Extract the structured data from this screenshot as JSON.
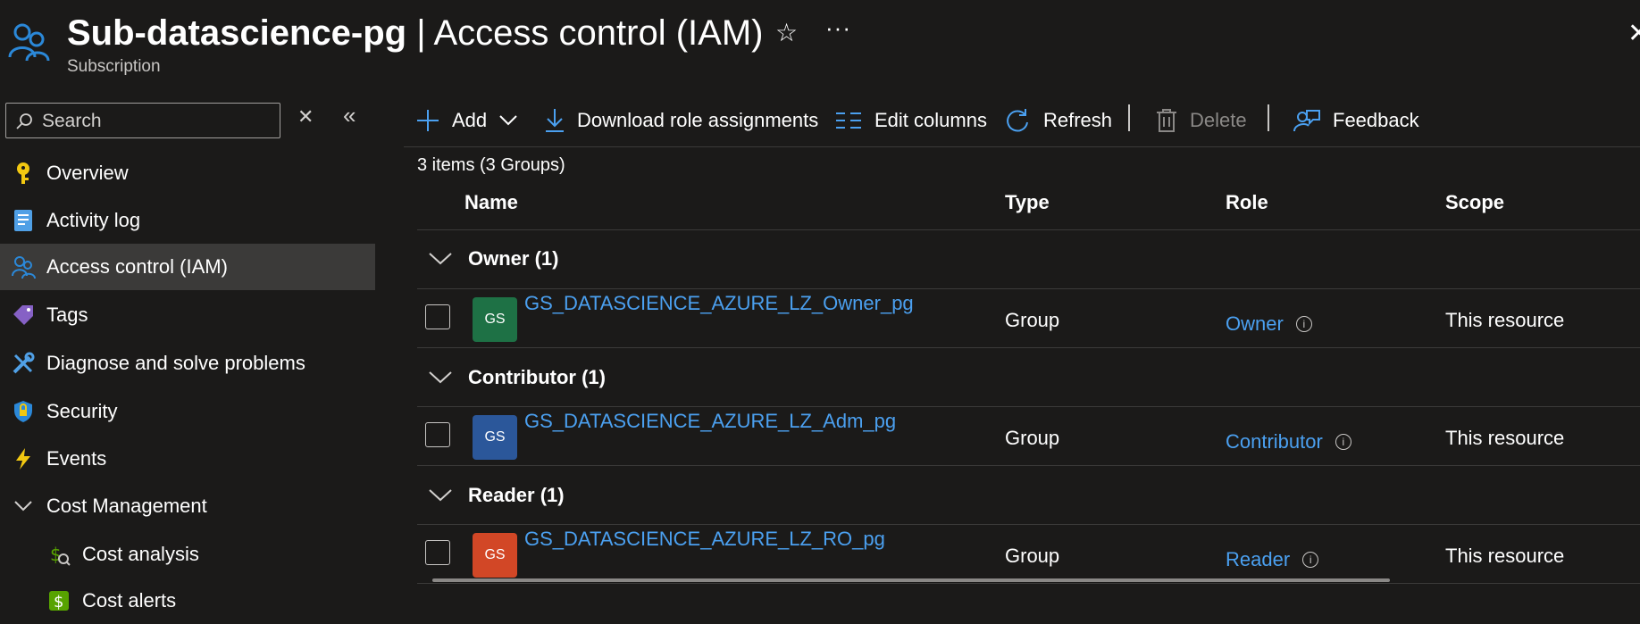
{
  "header": {
    "title_resource": "Sub-datascience-pg",
    "title_separator": "|",
    "title_page": "Access control (IAM)",
    "subtitle": "Subscription",
    "favorite_icon": "star-icon",
    "more_icon": "more-icon",
    "close_icon": "close-icon"
  },
  "search": {
    "placeholder": "Search",
    "value": ""
  },
  "sidebar": {
    "items": [
      {
        "label": "Overview",
        "icon": "key-icon"
      },
      {
        "label": "Activity log",
        "icon": "activity-log-icon"
      },
      {
        "label": "Access control (IAM)",
        "icon": "people-icon",
        "selected": true
      },
      {
        "label": "Tags",
        "icon": "tag-icon"
      },
      {
        "label": "Diagnose and solve problems",
        "icon": "wrench-icon"
      },
      {
        "label": "Security",
        "icon": "shield-icon"
      },
      {
        "label": "Events",
        "icon": "lightning-icon"
      },
      {
        "label": "Cost Management",
        "icon": "chevron-down-icon",
        "expanded": true
      },
      {
        "label": "Cost analysis",
        "icon": "cost-analysis-icon"
      },
      {
        "label": "Cost alerts",
        "icon": "cost-alerts-icon"
      }
    ]
  },
  "toolbar": {
    "add": "Add",
    "download": "Download role assignments",
    "edit_columns": "Edit columns",
    "refresh": "Refresh",
    "delete": "Delete",
    "feedback": "Feedback"
  },
  "grid": {
    "count": "3 items (3 Groups)",
    "columns": {
      "name": "Name",
      "type": "Type",
      "role": "Role",
      "scope": "Scope"
    },
    "groups": [
      {
        "label": "Owner (1)",
        "row": {
          "initials": "GS",
          "avatar_color": "#1e7145",
          "name": "GS_DATASCIENCE_AZURE_LZ_Owner_pg",
          "type": "Group",
          "role": "Owner",
          "scope": "This resource"
        }
      },
      {
        "label": "Contributor (1)",
        "row": {
          "initials": "GS",
          "avatar_color": "#2b579a",
          "name": "GS_DATASCIENCE_AZURE_LZ_Adm_pg",
          "type": "Group",
          "role": "Contributor",
          "scope": "This resource"
        }
      },
      {
        "label": "Reader (1)",
        "row": {
          "initials": "GS",
          "avatar_color": "#d24726",
          "name": "GS_DATASCIENCE_AZURE_LZ_RO_pg",
          "type": "Group",
          "role": "Reader",
          "scope": "This resource"
        }
      }
    ]
  },
  "colors": {
    "accent": "#4ba0f0",
    "background": "#1b1a19",
    "selected": "#3b3a39"
  }
}
